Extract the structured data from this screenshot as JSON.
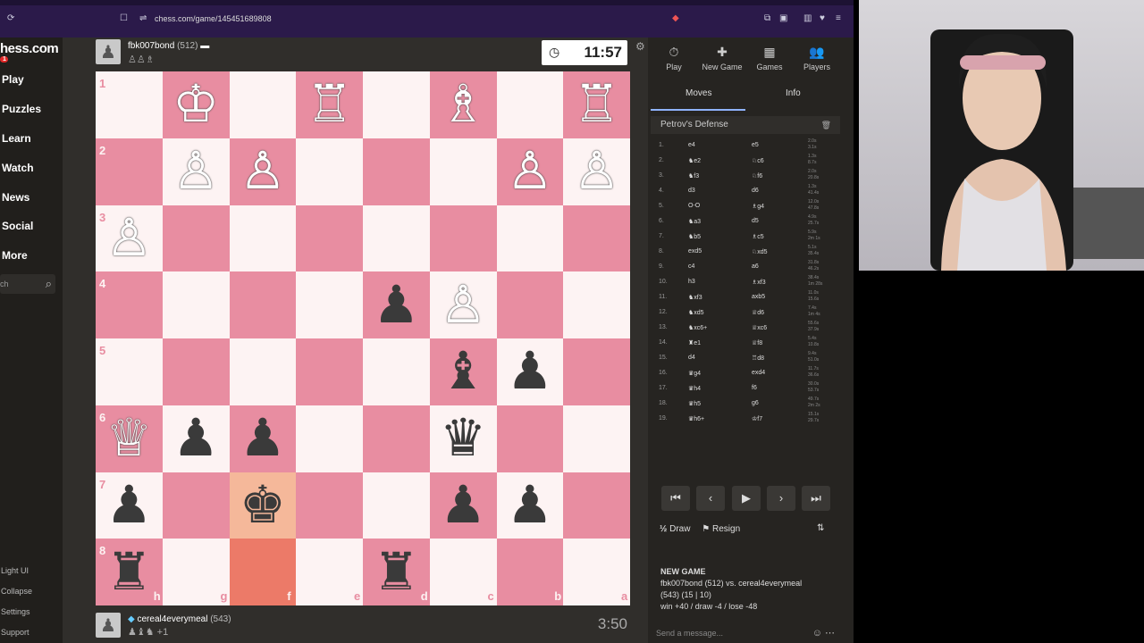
{
  "browser": {
    "url": "chess.com/game/145451689808"
  },
  "sidebar": {
    "logo": "hess.com",
    "badge": "1",
    "items": [
      {
        "label": "Play"
      },
      {
        "label": "Puzzles"
      },
      {
        "label": "Learn"
      },
      {
        "label": "Watch"
      },
      {
        "label": "News"
      },
      {
        "label": "Social"
      },
      {
        "label": "More"
      }
    ],
    "search_text": "ch",
    "bottom": [
      {
        "label": "Light UI"
      },
      {
        "label": "Collapse"
      },
      {
        "label": "Settings"
      },
      {
        "label": "Support"
      }
    ]
  },
  "top_player": {
    "name": "fbk007bond",
    "rating": "(512)",
    "clock": "11:57"
  },
  "bottom_player": {
    "name": "cereal4everymeal",
    "rating": "(543)",
    "extra": "+1",
    "clock": "3:50"
  },
  "board": {
    "ranks": [
      "1",
      "2",
      "3",
      "4",
      "5",
      "6",
      "7",
      "8"
    ],
    "files": [
      "h",
      "g",
      "f",
      "e",
      "d",
      "c",
      "b",
      "a"
    ],
    "pieces": [
      {
        "r": 0,
        "c": 1,
        "p": "♔",
        "side": "w"
      },
      {
        "r": 0,
        "c": 3,
        "p": "♖",
        "side": "w"
      },
      {
        "r": 0,
        "c": 5,
        "p": "♗",
        "side": "w"
      },
      {
        "r": 0,
        "c": 7,
        "p": "♖",
        "side": "w"
      },
      {
        "r": 1,
        "c": 1,
        "p": "♙",
        "side": "w"
      },
      {
        "r": 1,
        "c": 2,
        "p": "♙",
        "side": "w"
      },
      {
        "r": 1,
        "c": 6,
        "p": "♙",
        "side": "w"
      },
      {
        "r": 1,
        "c": 7,
        "p": "♙",
        "side": "w"
      },
      {
        "r": 2,
        "c": 0,
        "p": "♙",
        "side": "w"
      },
      {
        "r": 3,
        "c": 4,
        "p": "♟",
        "side": "b"
      },
      {
        "r": 3,
        "c": 5,
        "p": "♙",
        "side": "w"
      },
      {
        "r": 4,
        "c": 5,
        "p": "♝",
        "side": "b"
      },
      {
        "r": 4,
        "c": 6,
        "p": "♟",
        "side": "b"
      },
      {
        "r": 5,
        "c": 0,
        "p": "♕",
        "side": "w"
      },
      {
        "r": 5,
        "c": 1,
        "p": "♟",
        "side": "b"
      },
      {
        "r": 5,
        "c": 2,
        "p": "♟",
        "side": "b"
      },
      {
        "r": 5,
        "c": 5,
        "p": "♛",
        "side": "b"
      },
      {
        "r": 6,
        "c": 0,
        "p": "♟",
        "side": "b"
      },
      {
        "r": 6,
        "c": 2,
        "p": "♚",
        "side": "b"
      },
      {
        "r": 6,
        "c": 5,
        "p": "♟",
        "side": "b"
      },
      {
        "r": 6,
        "c": 6,
        "p": "♟",
        "side": "b"
      },
      {
        "r": 7,
        "c": 0,
        "p": "♜",
        "side": "b"
      },
      {
        "r": 7,
        "c": 4,
        "p": "♜",
        "side": "b"
      }
    ],
    "highlights": [
      {
        "r": 6,
        "c": 2,
        "k": "hl"
      },
      {
        "r": 7,
        "c": 2,
        "k": "hl2"
      }
    ]
  },
  "panel": {
    "tabs": [
      {
        "label": "Play",
        "icon": "⏱"
      },
      {
        "label": "New Game",
        "icon": "✚"
      },
      {
        "label": "Games",
        "icon": "▦"
      },
      {
        "label": "Players",
        "icon": "👥"
      }
    ],
    "subtabs": {
      "moves": "Moves",
      "info": "Info"
    },
    "opening": "Petrov's Defense",
    "moves": [
      {
        "n": "1.",
        "w": "e4",
        "b": "e5",
        "tw": "2.0s",
        "tb": "3.1s"
      },
      {
        "n": "2.",
        "w": "♞e2",
        "b": "♘c6",
        "tw": "1.3s",
        "tb": "8.7s"
      },
      {
        "n": "3.",
        "w": "♞f3",
        "b": "♘f6",
        "tw": "2.0s",
        "tb": "20.8s"
      },
      {
        "n": "4.",
        "w": "d3",
        "b": "d6",
        "tw": "1.3s",
        "tb": "41.4s"
      },
      {
        "n": "5.",
        "w": "O-O",
        "b": "♗g4",
        "tw": "12.0s",
        "tb": "47.8s"
      },
      {
        "n": "6.",
        "w": "♞a3",
        "b": "d5",
        "tw": "4.9s",
        "tb": "25.7s"
      },
      {
        "n": "7.",
        "w": "♞b5",
        "b": "♗c5",
        "tw": "5.9s",
        "tb": "2m 1s"
      },
      {
        "n": "8.",
        "w": "exd5",
        "b": "♘xd5",
        "tw": "5.1s",
        "tb": "35.4s"
      },
      {
        "n": "9.",
        "w": "c4",
        "b": "a6",
        "tw": "31.8s",
        "tb": "46.2s"
      },
      {
        "n": "10.",
        "w": "h3",
        "b": "♗xf3",
        "tw": "38.4s",
        "tb": "1m 28s"
      },
      {
        "n": "11.",
        "w": "♞xf3",
        "b": "axb5",
        "tw": "11.0s",
        "tb": "15.6s"
      },
      {
        "n": "12.",
        "w": "♞xd5",
        "b": "♕d6",
        "tw": "7.4s",
        "tb": "1m 4s"
      },
      {
        "n": "13.",
        "w": "♞xc6+",
        "b": "♕xc6",
        "tw": "55.6s",
        "tb": "37.9s"
      },
      {
        "n": "14.",
        "w": "♜e1",
        "b": "♕f8",
        "tw": "5.4s",
        "tb": "10.8s"
      },
      {
        "n": "15.",
        "w": "d4",
        "b": "♖d8",
        "tw": "9.4s",
        "tb": "51.0s"
      },
      {
        "n": "16.",
        "w": "♛g4",
        "b": "exd4",
        "tw": "11.7s",
        "tb": "36.6s"
      },
      {
        "n": "17.",
        "w": "♛h4",
        "b": "f6",
        "tw": "30.0s",
        "tb": "53.7s"
      },
      {
        "n": "18.",
        "w": "♛h5",
        "b": "g6",
        "tw": "49.7s",
        "tb": "2m 2s"
      },
      {
        "n": "19.",
        "w": "♛h6+",
        "b": "♔f7",
        "tw": "15.1s",
        "tb": "29.7s"
      }
    ],
    "draw": "Draw",
    "resign": "Resign",
    "draw_icon": "½",
    "resign_icon": "⚑",
    "newgame": {
      "title": "NEW GAME",
      "p1": "fbk007bond",
      "p1r": "(512)",
      "vs": "vs.",
      "p2": "cereal4everymeal",
      "line2": "(543) (15 | 10)",
      "line3": "win +40 / draw -4 / lose -48"
    },
    "message_placeholder": "Send a message..."
  }
}
